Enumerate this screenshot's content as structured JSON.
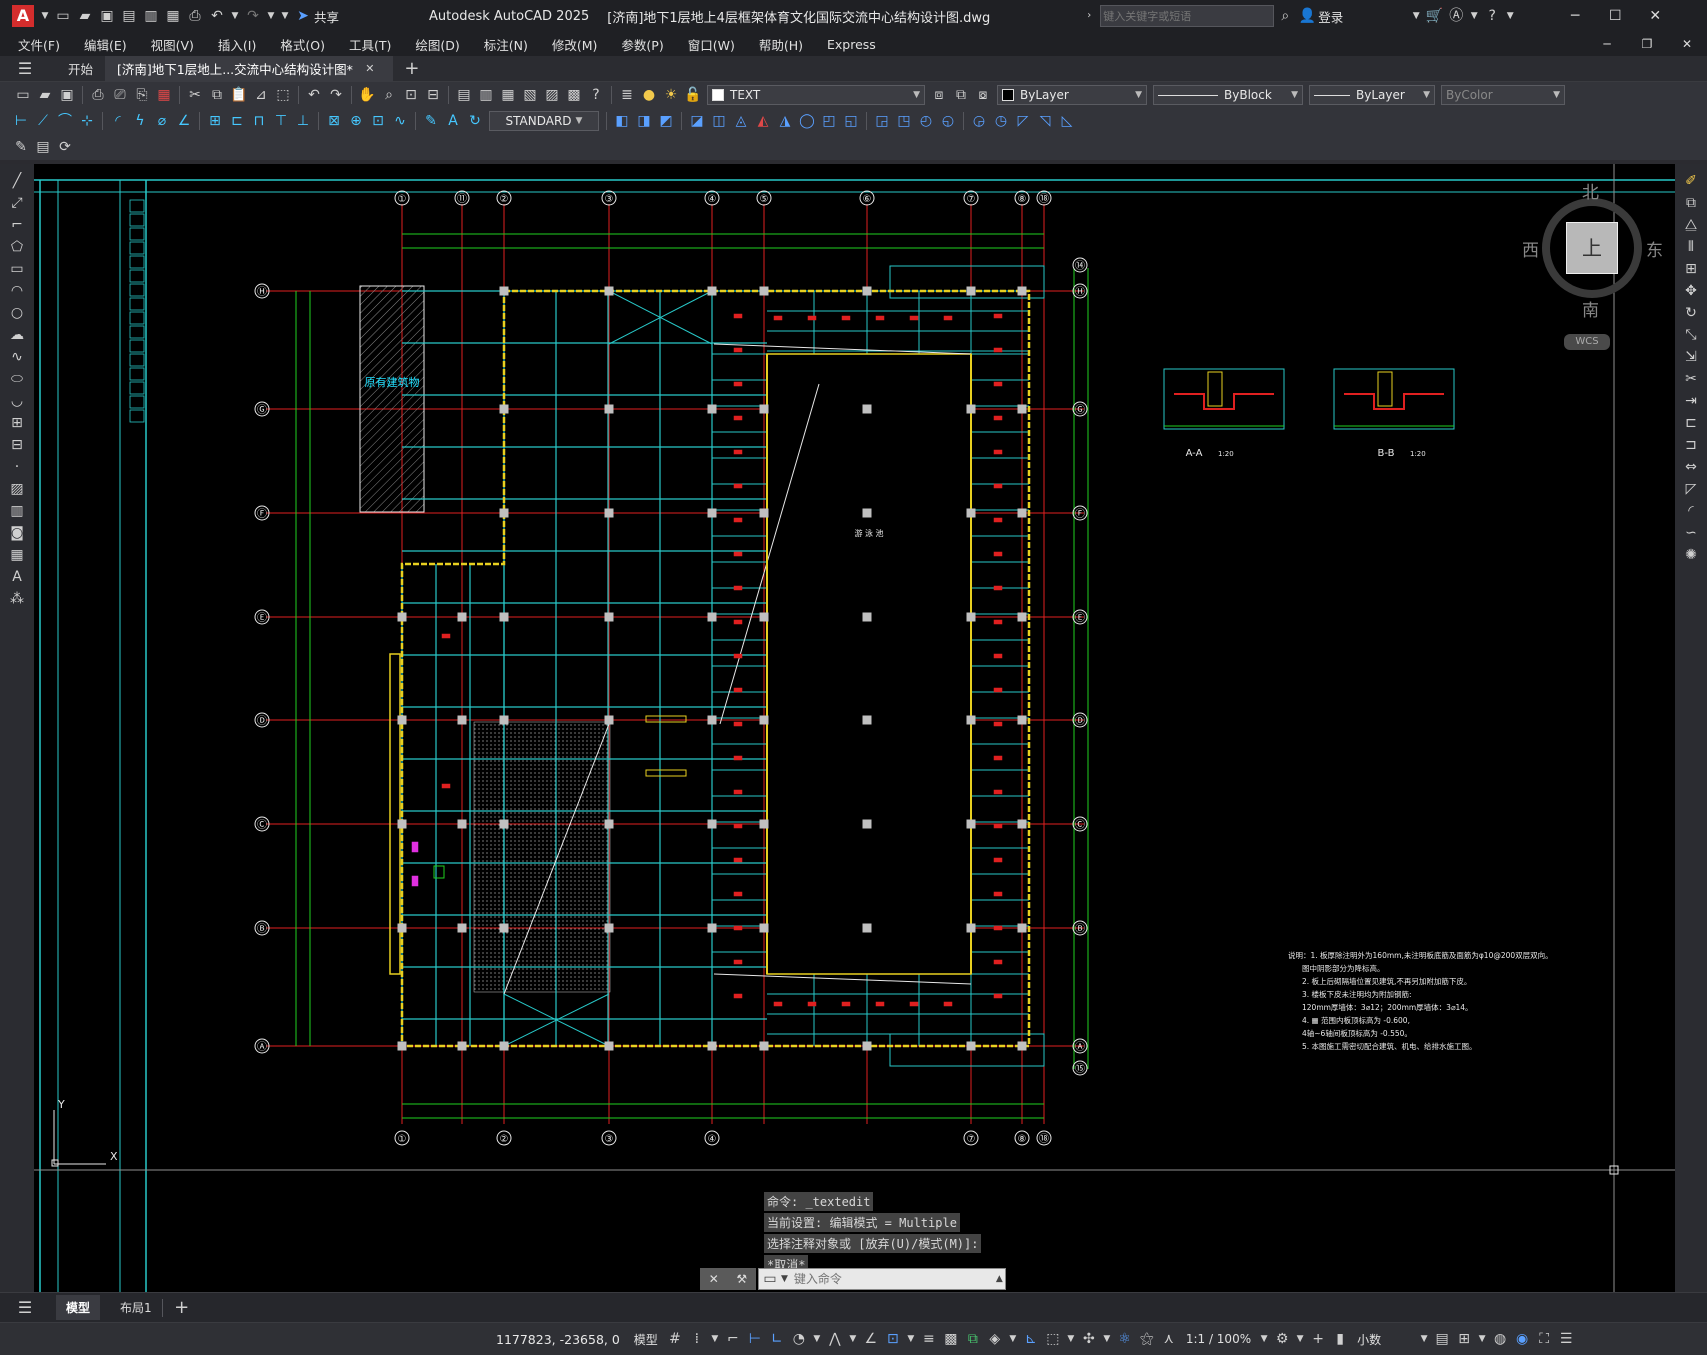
{
  "app": {
    "title": "Autodesk AutoCAD 2025",
    "document_title": "[济南]地下1层地上4层框架体育文化国际交流中心结构设计图.dwg",
    "share_label": "共享",
    "search_placeholder": "键入关键字或短语",
    "login_label": "登录"
  },
  "menu": [
    "文件(F)",
    "编辑(E)",
    "视图(V)",
    "插入(I)",
    "格式(O)",
    "工具(T)",
    "绘图(D)",
    "标注(N)",
    "修改(M)",
    "参数(P)",
    "窗口(W)",
    "帮助(H)",
    "Express"
  ],
  "tabs": {
    "start": "开始",
    "document": "[济南]地下1层地上...交流中心结构设计图*"
  },
  "toolbar": {
    "layer_name": "TEXT",
    "color": "ByLayer",
    "linetype": "ByBlock",
    "lineweight": "ByLayer",
    "plotstyle": "ByColor",
    "text_style": "STANDARD"
  },
  "viewcube": {
    "north": "北",
    "south": "南",
    "east": "东",
    "west": "西",
    "top": "上",
    "wcs": "WCS"
  },
  "drawing": {
    "grid_cols_top": [
      "①",
      "⑪",
      "②",
      "③",
      "④",
      "⑤",
      "⑥",
      "⑦",
      "⑧",
      "⑱"
    ],
    "grid_cols_bottom": [
      "①",
      "②",
      "③",
      "④",
      "⑦",
      "⑧",
      "⑱"
    ],
    "grid_rows": [
      "Ⓗ",
      "Ⓖ",
      "Ⓕ",
      "Ⓔ",
      "Ⓓ",
      "Ⓒ",
      "Ⓑ",
      "Ⓐ"
    ],
    "grid_rows_right_extra": [
      "⑭",
      "⑮"
    ],
    "existing_label": "原有建筑物",
    "pool_label": "游 泳 池",
    "section_a": "A-A",
    "section_b": "B-B",
    "section_scale": "1:20",
    "notes": [
      "说明：1. 板厚除注明外为160mm,未注明板底筋及面筋为φ10@200双层双向。",
      "图中阴影部分为降标高。",
      "2. 板上后砌隔墙位置见建筑,不再另加附加筋下皮。",
      "3. 楼板下皮未注明均为附加钢筋:",
      "120mm厚墙体：3⌀12；200mm厚墙体：3⌀14。",
      "4. ▦ 范围内板顶标高为 -0.600,",
      "4轴~6轴间板顶标高为 -0.550。",
      "5. 本图施工需密切配合建筑、机电、给排水施工图。"
    ],
    "axis_y": "Y",
    "axis_x": "X"
  },
  "command": {
    "history": [
      "命令: _textedit",
      "当前设置: 编辑模式 = Multiple",
      "选择注释对象或 [放弃(U)/模式(M)]:",
      "*取消*"
    ],
    "placeholder": "键入命令"
  },
  "layouts": {
    "model": "模型",
    "layout1": "布局1"
  },
  "status": {
    "coords": "1177823, -23658, 0",
    "model": "模型",
    "scale": "1:1 / 100%",
    "units": "小数"
  }
}
